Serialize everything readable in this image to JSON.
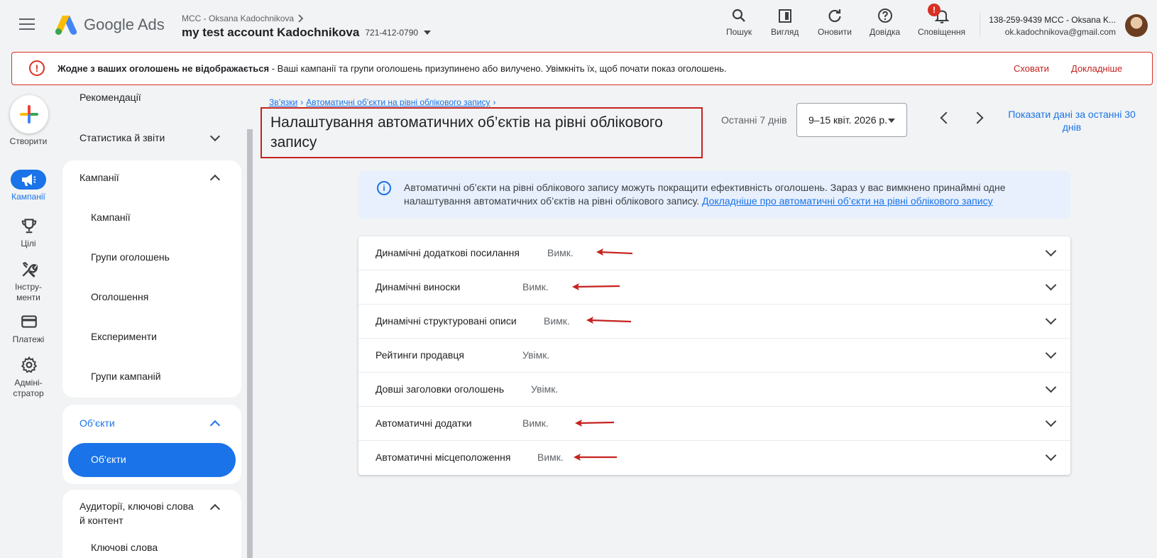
{
  "header": {
    "logo_text": "Google Ads",
    "mcc_label": "MCC - Oksana Kadochnikova",
    "account_name": "my test account Kadochnikova",
    "account_id": "721-412-0790",
    "tools": [
      {
        "label": "Пошук",
        "icon": "search-icon"
      },
      {
        "label": "Вигляд",
        "icon": "appearance-icon"
      },
      {
        "label": "Оновити",
        "icon": "refresh-icon"
      },
      {
        "label": "Довідка",
        "icon": "help-icon"
      },
      {
        "label": "Сповіщення",
        "icon": "bell-icon",
        "badge": "!"
      }
    ],
    "user_line1": "138-259-9439 MCC - Oksana K...",
    "user_email": "ok.kadochnikova@gmail.com"
  },
  "alert": {
    "bold": "Жодне з ваших оголошень не відображається",
    "text": " - Ваші кампанії та групи оголошень призупинено або вилучено. Увімкніть їх, щоб почати показ оголошень.",
    "hide_label": "Сховати",
    "more_label": "Докладніше",
    "color": "#d93025"
  },
  "rail": {
    "create_label": "Створити",
    "items": [
      {
        "label": "Кампанії",
        "icon": "megaphone-icon"
      },
      {
        "label": "Цілі",
        "icon": "trophy-icon"
      },
      {
        "label": "Інстру-менти",
        "line1": "Інстру-",
        "line2": "менти",
        "icon": "tools-icon"
      },
      {
        "label": "Платежі",
        "icon": "credit-card-icon"
      },
      {
        "label": "Адміні-стратор",
        "line1": "Адміні-",
        "line2": "стратор",
        "icon": "gear-icon"
      }
    ]
  },
  "nav": {
    "recommendations": "Рекомендації",
    "stats": "Статистика й звіти",
    "campaigns_header": "Кампанії",
    "campaigns_items": [
      "Кампанії",
      "Групи оголошень",
      "Оголошення",
      "Експерименти",
      "Групи кампаній"
    ],
    "assets_header": "Об’єкти",
    "assets_selected": "Об’єкти",
    "audiences_header_line1": "Аудиторії, ключові слова",
    "audiences_header_line2": "й контент",
    "keywords": "Ключові слова"
  },
  "content": {
    "breadcrumb": [
      "Зв’язки",
      "Автоматичні об’єкти на рівні облікового запису"
    ],
    "title": "Налаштування автоматичних об’єктів на рівні облікового запису",
    "date_range_label": "Останні 7 днів",
    "date_value": "9–15 квіт. 2026 р.",
    "show_30_days": "Показати дані за останні 30 днів",
    "info_text": "Автоматичні об’єкти на рівні облікового запису можуть покращити ефективність оголошень. Зараз у вас вимкнено принаймні одне налаштування автоматичних об’єктів на рівні облікового запису. ",
    "info_link": "Докладніше про автоматичні об’єкти на рівні облікового запису",
    "settings": [
      {
        "name": "Динамічні додаткові посилання",
        "status": "Вимк."
      },
      {
        "name": "Динамічні виноски",
        "status": "Вимк."
      },
      {
        "name": "Динамічні структуровані описи",
        "status": "Вимк."
      },
      {
        "name": "Рейтинги продавця",
        "status": "Увімк."
      },
      {
        "name": "Довші заголовки оголошень",
        "status": "Увімк."
      },
      {
        "name": "Автоматичні додатки",
        "status": "Вимк."
      },
      {
        "name": "Автоматичні місцеположення",
        "status": "Вимк."
      }
    ]
  },
  "colors": {
    "accent": "#1a73e8",
    "alert": "#d93025",
    "annotation": "#c5221f"
  }
}
